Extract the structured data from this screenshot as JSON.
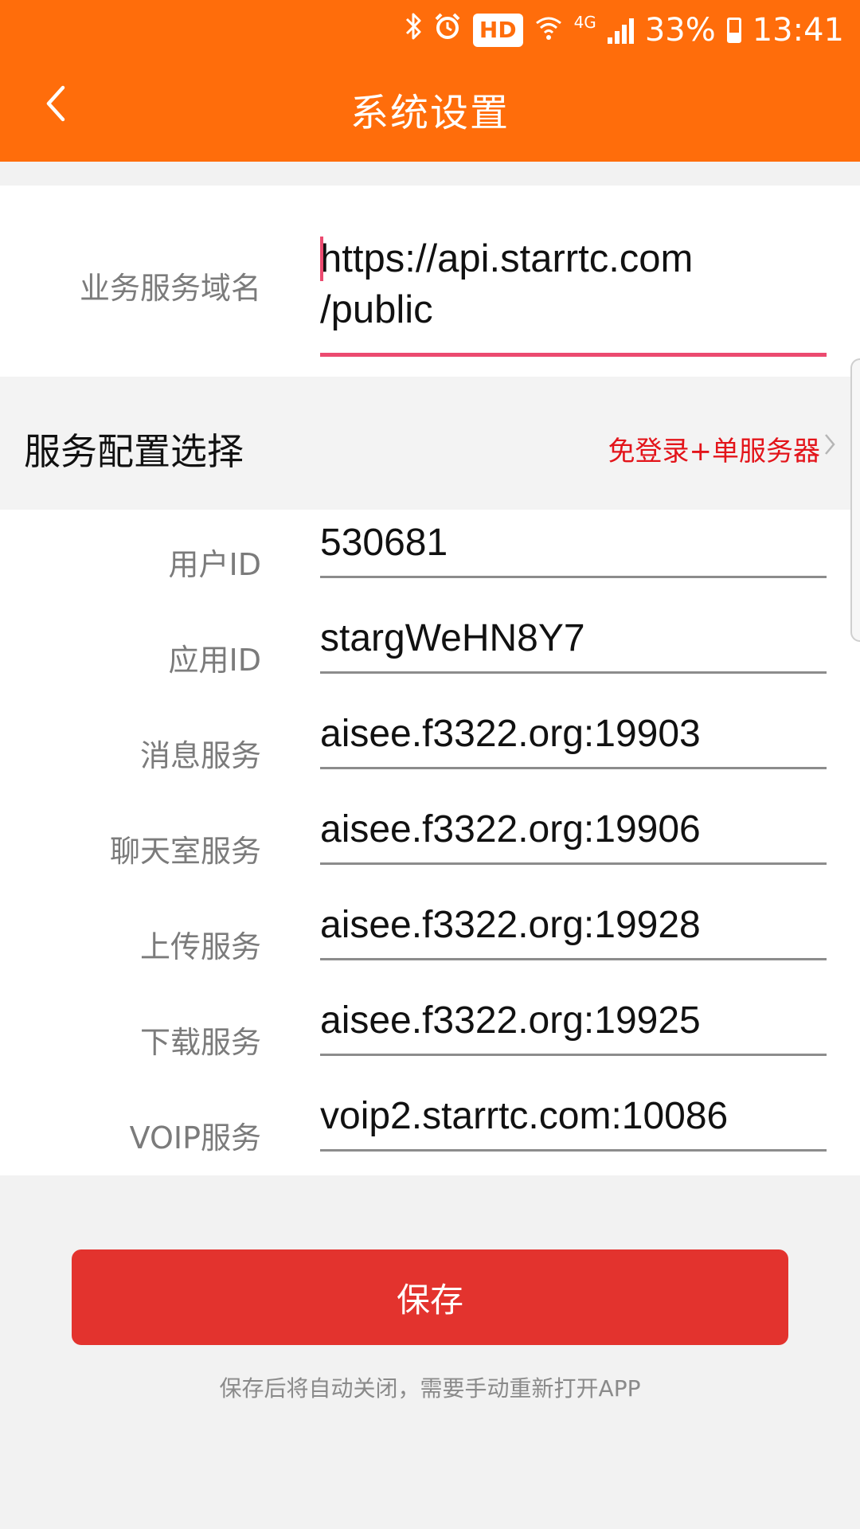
{
  "status_bar": {
    "icons": [
      "bluetooth-icon",
      "alarm-icon",
      "hd-badge",
      "wifi-icon",
      "network-4g",
      "signal-icon",
      "battery-icon"
    ],
    "hd_label": "HD",
    "network_label": "4G",
    "battery": "33%",
    "time": "13:41"
  },
  "header": {
    "title": "系统设置",
    "back_icon": "chevron-left-icon",
    "background": "#ff6d0b"
  },
  "domain": {
    "label": "业务服务域名",
    "value_line1": "https://api.starrtc.com",
    "value_line2": "/public",
    "underline_color": "#ec4a6f"
  },
  "config": {
    "title": "服务配置选择",
    "value": "免登录+单服务器",
    "value_color": "#e3141a"
  },
  "fields": [
    {
      "label": "用户ID",
      "value": "530681"
    },
    {
      "label": "应用ID",
      "value": "stargWeHN8Y7"
    },
    {
      "label": "消息服务",
      "value": "aisee.f3322.org:19903"
    },
    {
      "label": "聊天室服务",
      "value": "aisee.f3322.org:19906"
    },
    {
      "label": "上传服务",
      "value": "aisee.f3322.org:19928"
    },
    {
      "label": "下载服务",
      "value": "aisee.f3322.org:19925"
    },
    {
      "label": "VOIP服务",
      "value": "voip2.starrtc.com:10086"
    }
  ],
  "save_button": {
    "label": "保存",
    "color": "#e3332e"
  },
  "hint": "保存后将自动关闭，需要手动重新打开APP"
}
